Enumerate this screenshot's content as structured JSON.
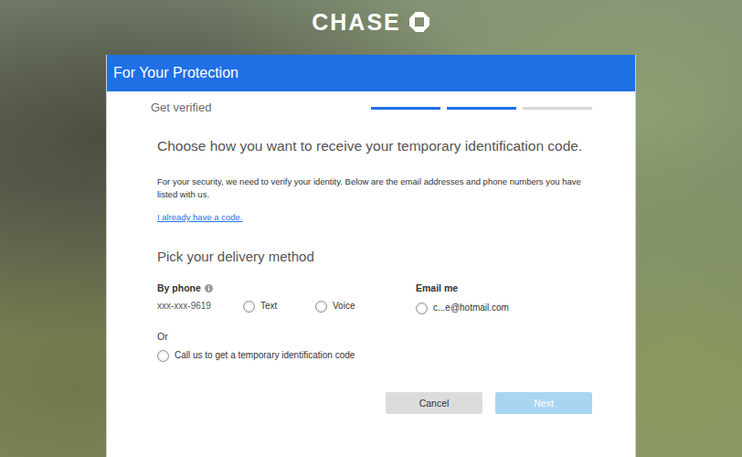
{
  "logo": {
    "text": "CHASE"
  },
  "dialog": {
    "title": "For Your Protection"
  },
  "steps": {
    "label": "Get verified",
    "segments": [
      {
        "done": true
      },
      {
        "done": true
      },
      {
        "done": false
      }
    ]
  },
  "heading": "Choose how you want to receive your temporary identification code.",
  "intro": "For your security, we need to verify your identity. Below are the email addresses and phone numbers you have listed with us.",
  "link": "I already have a code.",
  "section_title": "Pick your delivery method",
  "phone": {
    "label": "By phone",
    "number": "xxx-xxx-9619",
    "options": [
      {
        "label": "Text",
        "selected": false
      },
      {
        "label": "Voice",
        "selected": false
      }
    ]
  },
  "email": {
    "label": "Email me",
    "options": [
      {
        "label": "c...e@hotmail.com",
        "selected": false
      }
    ]
  },
  "alternative": {
    "label": "Or",
    "option": {
      "label": "Call us to get a temporary identification code",
      "selected": false
    }
  },
  "buttons": [
    {
      "label": "Cancel",
      "disabled": false,
      "primary": false
    },
    {
      "label": "Next",
      "disabled": true,
      "primary": true
    }
  ]
}
